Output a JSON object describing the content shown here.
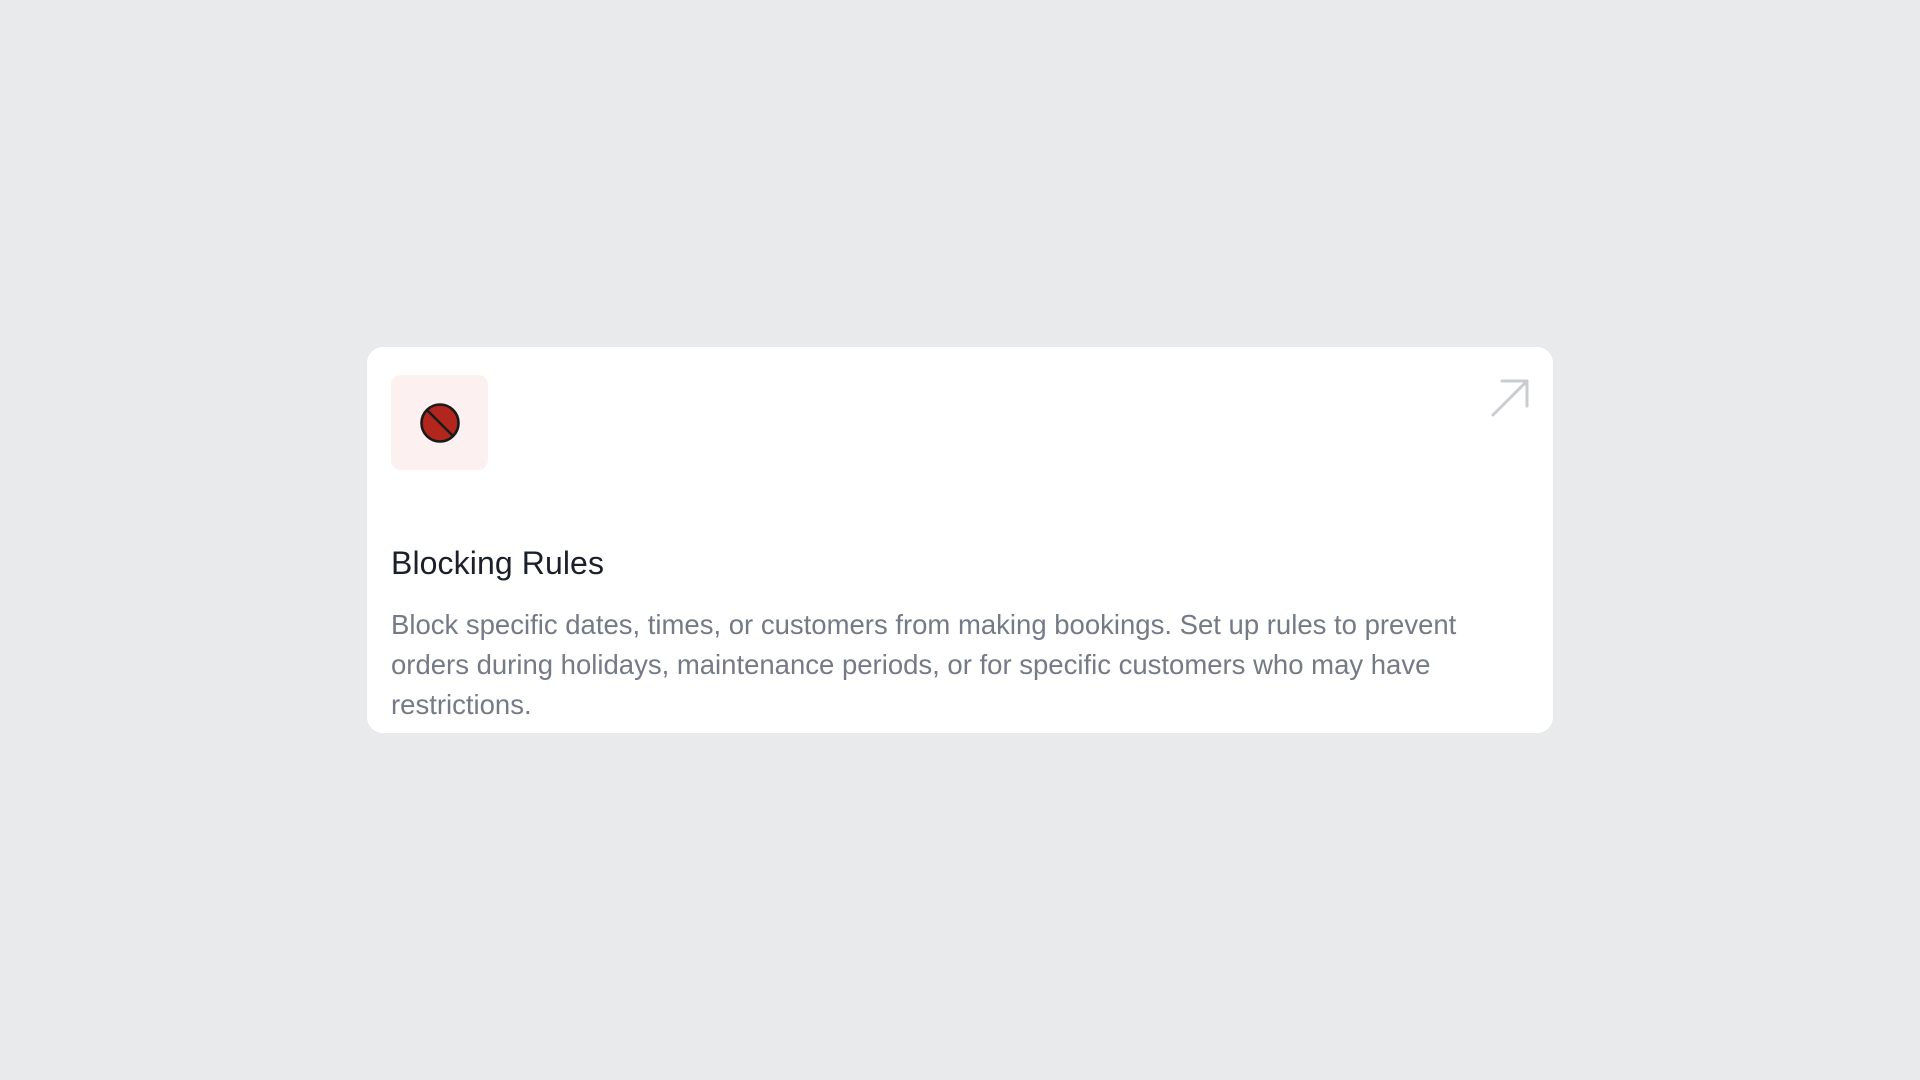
{
  "card": {
    "title": "Blocking Rules",
    "description": "Block specific dates, times, or customers from making bookings. Set up rules to prevent orders during holidays, maintenance periods, or for specific customers who may have restrictions.",
    "icon": "block-icon",
    "link_icon": "arrow-up-right-icon"
  },
  "colors": {
    "page_background": "#e9eaec",
    "card_background": "#ffffff",
    "icon_tile_background": "#fdf0f0",
    "icon_fill": "#b3261e",
    "title": "#1b1f2a",
    "description": "#747a86",
    "link_arrow": "#c9ccd2"
  }
}
